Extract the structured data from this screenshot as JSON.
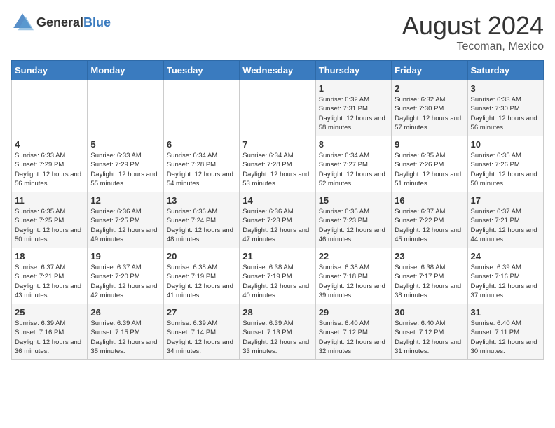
{
  "logo": {
    "general": "General",
    "blue": "Blue"
  },
  "title": "August 2024",
  "location": "Tecoman, Mexico",
  "days_header": [
    "Sunday",
    "Monday",
    "Tuesday",
    "Wednesday",
    "Thursday",
    "Friday",
    "Saturday"
  ],
  "weeks": [
    [
      {
        "day": "",
        "info": ""
      },
      {
        "day": "",
        "info": ""
      },
      {
        "day": "",
        "info": ""
      },
      {
        "day": "",
        "info": ""
      },
      {
        "day": "1",
        "info": "Sunrise: 6:32 AM\nSunset: 7:31 PM\nDaylight: 12 hours\nand 58 minutes."
      },
      {
        "day": "2",
        "info": "Sunrise: 6:32 AM\nSunset: 7:30 PM\nDaylight: 12 hours\nand 57 minutes."
      },
      {
        "day": "3",
        "info": "Sunrise: 6:33 AM\nSunset: 7:30 PM\nDaylight: 12 hours\nand 56 minutes."
      }
    ],
    [
      {
        "day": "4",
        "info": "Sunrise: 6:33 AM\nSunset: 7:29 PM\nDaylight: 12 hours\nand 56 minutes."
      },
      {
        "day": "5",
        "info": "Sunrise: 6:33 AM\nSunset: 7:29 PM\nDaylight: 12 hours\nand 55 minutes."
      },
      {
        "day": "6",
        "info": "Sunrise: 6:34 AM\nSunset: 7:28 PM\nDaylight: 12 hours\nand 54 minutes."
      },
      {
        "day": "7",
        "info": "Sunrise: 6:34 AM\nSunset: 7:28 PM\nDaylight: 12 hours\nand 53 minutes."
      },
      {
        "day": "8",
        "info": "Sunrise: 6:34 AM\nSunset: 7:27 PM\nDaylight: 12 hours\nand 52 minutes."
      },
      {
        "day": "9",
        "info": "Sunrise: 6:35 AM\nSunset: 7:26 PM\nDaylight: 12 hours\nand 51 minutes."
      },
      {
        "day": "10",
        "info": "Sunrise: 6:35 AM\nSunset: 7:26 PM\nDaylight: 12 hours\nand 50 minutes."
      }
    ],
    [
      {
        "day": "11",
        "info": "Sunrise: 6:35 AM\nSunset: 7:25 PM\nDaylight: 12 hours\nand 50 minutes."
      },
      {
        "day": "12",
        "info": "Sunrise: 6:36 AM\nSunset: 7:25 PM\nDaylight: 12 hours\nand 49 minutes."
      },
      {
        "day": "13",
        "info": "Sunrise: 6:36 AM\nSunset: 7:24 PM\nDaylight: 12 hours\nand 48 minutes."
      },
      {
        "day": "14",
        "info": "Sunrise: 6:36 AM\nSunset: 7:23 PM\nDaylight: 12 hours\nand 47 minutes."
      },
      {
        "day": "15",
        "info": "Sunrise: 6:36 AM\nSunset: 7:23 PM\nDaylight: 12 hours\nand 46 minutes."
      },
      {
        "day": "16",
        "info": "Sunrise: 6:37 AM\nSunset: 7:22 PM\nDaylight: 12 hours\nand 45 minutes."
      },
      {
        "day": "17",
        "info": "Sunrise: 6:37 AM\nSunset: 7:21 PM\nDaylight: 12 hours\nand 44 minutes."
      }
    ],
    [
      {
        "day": "18",
        "info": "Sunrise: 6:37 AM\nSunset: 7:21 PM\nDaylight: 12 hours\nand 43 minutes."
      },
      {
        "day": "19",
        "info": "Sunrise: 6:37 AM\nSunset: 7:20 PM\nDaylight: 12 hours\nand 42 minutes."
      },
      {
        "day": "20",
        "info": "Sunrise: 6:38 AM\nSunset: 7:19 PM\nDaylight: 12 hours\nand 41 minutes."
      },
      {
        "day": "21",
        "info": "Sunrise: 6:38 AM\nSunset: 7:19 PM\nDaylight: 12 hours\nand 40 minutes."
      },
      {
        "day": "22",
        "info": "Sunrise: 6:38 AM\nSunset: 7:18 PM\nDaylight: 12 hours\nand 39 minutes."
      },
      {
        "day": "23",
        "info": "Sunrise: 6:38 AM\nSunset: 7:17 PM\nDaylight: 12 hours\nand 38 minutes."
      },
      {
        "day": "24",
        "info": "Sunrise: 6:39 AM\nSunset: 7:16 PM\nDaylight: 12 hours\nand 37 minutes."
      }
    ],
    [
      {
        "day": "25",
        "info": "Sunrise: 6:39 AM\nSunset: 7:16 PM\nDaylight: 12 hours\nand 36 minutes."
      },
      {
        "day": "26",
        "info": "Sunrise: 6:39 AM\nSunset: 7:15 PM\nDaylight: 12 hours\nand 35 minutes."
      },
      {
        "day": "27",
        "info": "Sunrise: 6:39 AM\nSunset: 7:14 PM\nDaylight: 12 hours\nand 34 minutes."
      },
      {
        "day": "28",
        "info": "Sunrise: 6:39 AM\nSunset: 7:13 PM\nDaylight: 12 hours\nand 33 minutes."
      },
      {
        "day": "29",
        "info": "Sunrise: 6:40 AM\nSunset: 7:12 PM\nDaylight: 12 hours\nand 32 minutes."
      },
      {
        "day": "30",
        "info": "Sunrise: 6:40 AM\nSunset: 7:12 PM\nDaylight: 12 hours\nand 31 minutes."
      },
      {
        "day": "31",
        "info": "Sunrise: 6:40 AM\nSunset: 7:11 PM\nDaylight: 12 hours\nand 30 minutes."
      }
    ]
  ]
}
